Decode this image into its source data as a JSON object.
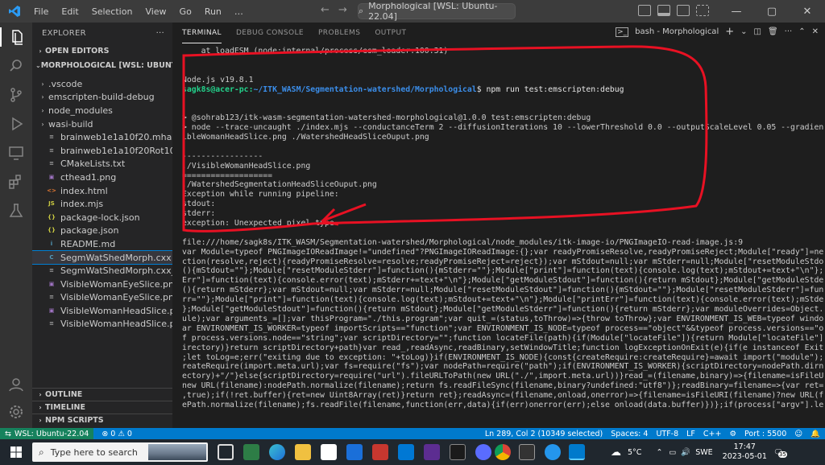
{
  "titlebar": {
    "menus": [
      "File",
      "Edit",
      "Selection",
      "View",
      "Go",
      "Run",
      "…"
    ],
    "command_center": "Morphological [WSL: Ubuntu-22.04]"
  },
  "sidebar": {
    "title": "EXPLORER",
    "open_editors": "OPEN EDITORS",
    "workspace": "MORPHOLOGICAL [WSL: UBUNTU-22....",
    "items": [
      {
        "label": ".vscode",
        "type": "folder"
      },
      {
        "label": "emscripten-build-debug",
        "type": "folder"
      },
      {
        "label": "node_modules",
        "type": "folder"
      },
      {
        "label": "wasi-build",
        "type": "folder"
      },
      {
        "label": "brainweb1e1a10f20.mha",
        "type": "file"
      },
      {
        "label": "brainweb1e1a10f20Rot10Tx15.m...",
        "type": "file"
      },
      {
        "label": "CMakeLists.txt",
        "type": "cmake"
      },
      {
        "label": "cthead1.png",
        "type": "image"
      },
      {
        "label": "index.html",
        "type": "html"
      },
      {
        "label": "index.mjs",
        "type": "js"
      },
      {
        "label": "package-lock.json",
        "type": "json"
      },
      {
        "label": "package.json",
        "type": "json"
      },
      {
        "label": "README.md",
        "type": "md"
      },
      {
        "label": "SegmWatShedMorph.cxx",
        "type": "cxx"
      },
      {
        "label": "SegmWatShedMorph.cxx_bak",
        "type": "file"
      },
      {
        "label": "VisibleWomanEyeSlice.png",
        "type": "image"
      },
      {
        "label": "VisibleWomanEyeSlice.png:Zone...",
        "type": "file"
      },
      {
        "label": "VisibleWomanHeadSlice.png",
        "type": "image"
      },
      {
        "label": "VisibleWomanHeadSlice.png:Zon...",
        "type": "file"
      }
    ],
    "selected_index": 13,
    "bottom_sections": [
      "OUTLINE",
      "TIMELINE",
      "NPM SCRIPTS"
    ]
  },
  "panel": {
    "tabs": [
      "TERMINAL",
      "DEBUG CONSOLE",
      "PROBLEMS",
      "OUTPUT"
    ],
    "active_tab": 0,
    "terminal_name": "bash - Morphological"
  },
  "terminal": {
    "lines": [
      "    at loadESM (node:internal/process/esm_loader:100:31)",
      "",
      "",
      "Node.js v19.8.1",
      "",
      "",
      "> @sohrab123/itk-wasm-segmentation-watershed-morphological@1.0.0 test:emscripten:debug",
      "> node --trace-uncaught ./index.mjs --conductanceTerm 2 --diffusionIterations 10 --lowerThreshold 0.0 --outputScaleLevel 0.05 --gradientMode 1 ./Vis",
      "ibleWomanHeadSlice.png ./WatershedHeadSliceOuput.png",
      "",
      "-----------------",
      "./VisibleWomanHeadSlice.png",
      "===================",
      "./WatershedSegmentationHeadSliceOuput.png",
      "Exception while running pipeline:",
      "stdout:",
      "stderr:",
      "exception: Unexpected pixel type",
      "",
      "file:///home/sagk8s/ITK_WASM/Segmentation-watershed/Morphological/node_modules/itk-image-io/PNGImageIO-read-image.js:9",
      "var Module=typeof PNGImageIOReadImage!=\"undefined\"?PNGImageIOReadImage:{};var readyPromiseResolve,readyPromiseReject;Module[\"ready\"]=new Promise(fun",
      "ction(resolve,reject){readyPromiseResolve=resolve;readyPromiseReject=reject});var mStdout=null;var mStderr=null;Module[\"resetModuleStdout\"]=function",
      "(){mStdout=\"\"};Module[\"resetModuleStderr\"]=function(){mStderr=\"\"};Module[\"print\"]=function(text){console.log(text);mStdout+=text+\"\\n\"};Module[\"print",
      "Err\"]=function(text){console.error(text);mStderr+=text+\"\\n\"};Module[\"getModuleStdout\"]=function(){return mStdout};Module[\"getModuleStderr\"]=function",
      "(){return mStderr};var mStdout=null;var mStderr=null;Module[\"resetModuleStdout\"]=function(){mStdout=\"\"};Module[\"resetModuleStderr\"]=function(){mStde",
      "rr=\"\"};Module[\"print\"]=function(text){console.log(text);mStdout+=text+\"\\n\"};Module[\"printErr\"]=function(text){console.error(text);mStderr+=text+\"\\n\"",
      "};Module[\"getModuleStdout\"]=function(){return mStdout};Module[\"getModuleStderr\"]=function(){return mStderr};var moduleOverrides=Object.assign({},Mod",
      "ule);var arguments_=[];var thisProgram=\"./this.program\";var quit_=(status,toThrow)=>{throw toThrow};var ENVIRONMENT_IS_WEB=typeof window==\"object\";v",
      "ar ENVIRONMENT_IS_WORKER=typeof importScripts==\"function\";var ENVIRONMENT_IS_NODE=typeof process==\"object\"&&typeof process.versions==\"object\"&&typeo",
      "f process.versions.node==\"string\";var scriptDirectory=\"\";function locateFile(path){if(Module[\"locateFile\"]){return Module[\"locateFile\"](path,scriptD",
      "irectory)}return scriptDirectory+path}var read_,readAsync,readBinary,setWindowTitle;function logExceptionOnExit(e){if(e instanceof ExitStatus)return",
      ";let toLog=e;err(\"exiting due to exception: \"+toLog)}if(ENVIRONMENT_IS_NODE){const{createRequire:createRequire}=await import(\"module\");var require=c",
      "reateRequire(import.meta.url);var fs=require(\"fs\");var nodePath=require(\"path\");if(ENVIRONMENT_IS_WORKER){scriptDirectory=nodePath.dirname(scriptDir",
      "ectory)+\"/\"}else{scriptDirectory=require(\"url\").fileURLToPath(new URL(\"./\",import.meta.url))}read_=(filename,binary)=>{filename=isFileURI(filename)?",
      "new URL(filename):nodePath.normalize(filename);return fs.readFileSync(filename,binary?undefined:\"utf8\")};readBinary=filename=>{var ret=read_(filename",
      ",true);if(!ret.buffer){ret=new Uint8Array(ret)}return ret};readAsync=(filename,onload,onerror)=>{filename=isFileURI(filename)?new URL(filename):nod",
      "ePath.normalize(filename);fs.readFile(filename,function(err,data){if(err)onerror(err);else onload(data.buffer)})};if(process[\"argv\"].length>1){thisP"
    ],
    "prompt_user": "sagk8s@acer-pc",
    "prompt_path": "~/ITK_WASM/Segmentation-watershed/Morphological",
    "prompt_cmd": "$ npm run test:emscripten:debug"
  },
  "statusbar": {
    "remote": "WSL: Ubuntu-22.04",
    "problems": "⊗ 0  ⚠ 0",
    "position": "Ln 289, Col 2 (10349 selected)",
    "spaces": "Spaces: 4",
    "encoding": "UTF-8",
    "eol": "LF",
    "language": "C++",
    "port": "Port : 5500"
  },
  "taskbar": {
    "search_placeholder": "Type here to search",
    "weather": "5°C",
    "lang": "SWE",
    "time": "17:47",
    "date": "2023-05-01",
    "notifications": "35"
  },
  "colors": {
    "accent": "#007acc",
    "remote": "#16825d",
    "prompt_green": "#23d18b",
    "prompt_blue": "#3b8eea",
    "annotation_red": "#e81123"
  }
}
